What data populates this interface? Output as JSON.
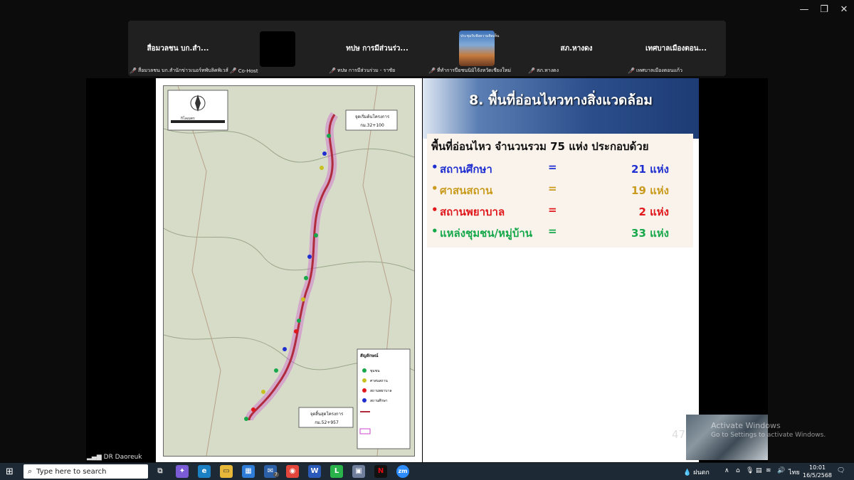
{
  "window": {
    "minimize": "—",
    "maximize": "❐",
    "close": "✕"
  },
  "participants": [
    {
      "name": "สื่อมวลชน บก.สำ...",
      "caption": "สื่อมวลชน บก.สำนักข่าวเนอร์ทพับลิคพิเวส์",
      "extra": "Co-Host"
    },
    {
      "name": "",
      "caption": ""
    },
    {
      "name": "ทปษ การมีส่วนร่ว...",
      "caption": "ทปษ การมีส่วนร่วม - ราชัย"
    },
    {
      "name": "",
      "caption": "ที่ทำการปี่ยชนนิมิไจังหวัดเชียงใหม่",
      "thumb_label": "ประชุมรับฟังความคิดเห็น"
    },
    {
      "name": "สภ.หางดง",
      "caption": "สภ.หางดง"
    },
    {
      "name": "เทศบาลเมืองตอน...",
      "caption": "เทศบาลเมืองตอนแก้ว"
    }
  ],
  "slide": {
    "title": "8. พื้นที่อ่อนไหวทางสิ่งแวดล้อม",
    "heading": "พื้นที่อ่อนไหว จำนวนรวม 75 แห่ง ประกอบด้วย",
    "rows": [
      {
        "label": "สถานศึกษา",
        "eq": "=",
        "value": "21 แห่ง",
        "color": "#1f2fd0"
      },
      {
        "label": "ศาสนสถาน",
        "eq": "=",
        "value": "19 แห่ง",
        "color": "#c99a1c"
      },
      {
        "label": "สถานพยาบาล",
        "eq": "=",
        "value": "2 แห่ง",
        "color": "#e0171b"
      },
      {
        "label": "แหล่งชุมชน/หมู่บ้าน",
        "eq": "=",
        "value": "33 แห่ง",
        "color": "#16a84a"
      }
    ],
    "page_number": "47"
  },
  "map": {
    "start_label": "จุดเริ่มต้นโครงการ",
    "start_km": "กม.32+100",
    "end_label": "จุดสิ้นสุดโครงการ",
    "end_km": "กม.52+957",
    "scale_unit": "กิโลเมตร",
    "legend_title": "สัญลักษณ์",
    "legend_items": [
      "ชุมชน",
      "ศาสนสถาน",
      "สถานพยาบาล",
      "สถานศึกษา"
    ]
  },
  "overlay": {
    "activate_title": "Activate Windows",
    "activate_sub": "Go to Settings to activate Windows.",
    "presenter": "DR Daoreuk"
  },
  "taskbar": {
    "search_placeholder": "Type here to search",
    "weather": "ฝนตก",
    "language": "ไทย",
    "time": "10:01",
    "date": "16/5/2568",
    "badge": "7"
  }
}
